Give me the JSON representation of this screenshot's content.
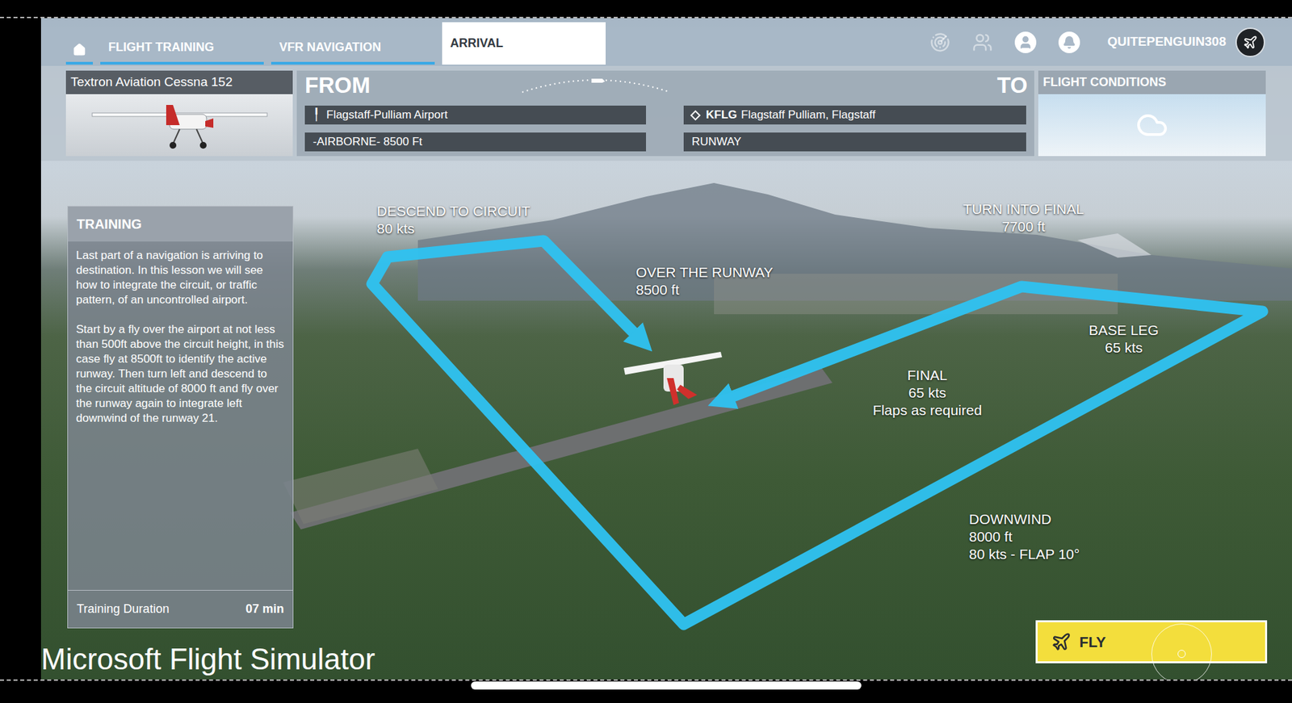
{
  "nav": {
    "tabs": [
      {
        "label": "FLIGHT TRAINING",
        "selected": false
      },
      {
        "label": "VFR NAVIGATION",
        "selected": false
      },
      {
        "label": "ARRIVAL",
        "selected": true
      }
    ],
    "user": "QUITEPENGUIN308"
  },
  "aircraft": {
    "name": "Textron Aviation Cessna 152"
  },
  "route": {
    "from_label": "FROM",
    "to_label": "TO",
    "from": {
      "airport": "Flagstaff-Pulliam Airport",
      "start": "-AIRBORNE- 8500 Ft"
    },
    "to": {
      "code": "KFLG",
      "airport": "Flagstaff Pulliam, Flagstaff",
      "start": "RUNWAY"
    }
  },
  "conditions": {
    "title": "FLIGHT CONDITIONS"
  },
  "training": {
    "title": "TRAINING",
    "paragraphs": [
      "Last part of a navigation is arriving to destination. In this lesson we will see how to integrate the circuit, or traffic pattern, of an uncontrolled airport.",
      "Start by a fly over the airport at not less than 500ft above the circuit height, in this case fly at 8500ft to identify the active runway. Then turn left and descend to the circuit altitude of 8000 ft and fly over the runway again to integrate left downwind of the runway 21."
    ],
    "duration_label": "Training Duration",
    "duration": "07 min"
  },
  "circuit_labels": [
    {
      "lines": [
        "DESCEND TO CIRCUIT",
        "80 kts"
      ]
    },
    {
      "lines": [
        "OVER THE RUNWAY",
        "8500 ft"
      ]
    },
    {
      "lines": [
        "TURN INTO FINAL",
        "7700 ft"
      ]
    },
    {
      "lines": [
        "BASE LEG",
        "65 kts"
      ]
    },
    {
      "lines": [
        "FINAL",
        "65 kts",
        "Flaps as required"
      ]
    },
    {
      "lines": [
        "DOWNWIND",
        "8000 ft",
        "80 kts - FLAP 10°"
      ]
    }
  ],
  "fly_button": "FLY",
  "watermark": "Microsoft Flight Simulator"
}
